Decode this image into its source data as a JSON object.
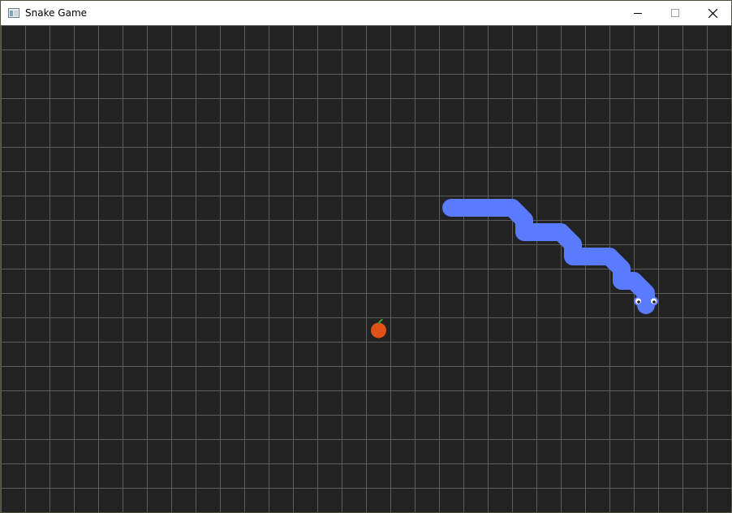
{
  "window": {
    "title": "Snake Game",
    "minimize_icon": "minimize-icon",
    "maximize_icon": "maximize-icon",
    "close_icon": "close-icon"
  },
  "game": {
    "grid": {
      "columns": 30,
      "rows": 20
    },
    "snake_color": "#5b7bff",
    "snake_path_cells": [
      [
        18.5,
        7.5
      ],
      [
        20.5,
        7.5
      ],
      [
        21,
        7.5
      ],
      [
        21.5,
        8
      ],
      [
        21.5,
        8.5
      ],
      [
        22,
        8.5
      ],
      [
        22.5,
        8.5
      ],
      [
        23,
        8.5
      ],
      [
        23.5,
        9
      ],
      [
        23.5,
        9.5
      ],
      [
        24,
        9.5
      ],
      [
        24.5,
        9.5
      ],
      [
        25,
        9.5
      ],
      [
        25.5,
        10
      ],
      [
        25.5,
        10.5
      ],
      [
        26,
        10.5
      ],
      [
        26.5,
        11
      ],
      [
        26.5,
        11.5
      ]
    ],
    "snake_head_cell": [
      26,
      11
    ],
    "snake_direction": "down",
    "food": {
      "type": "apple",
      "color": "#e0521a",
      "stem_color": "#3a9a2a",
      "cell": [
        15,
        12
      ]
    },
    "grid_line_color": "#5c5c5c",
    "background_color": "#222222"
  }
}
